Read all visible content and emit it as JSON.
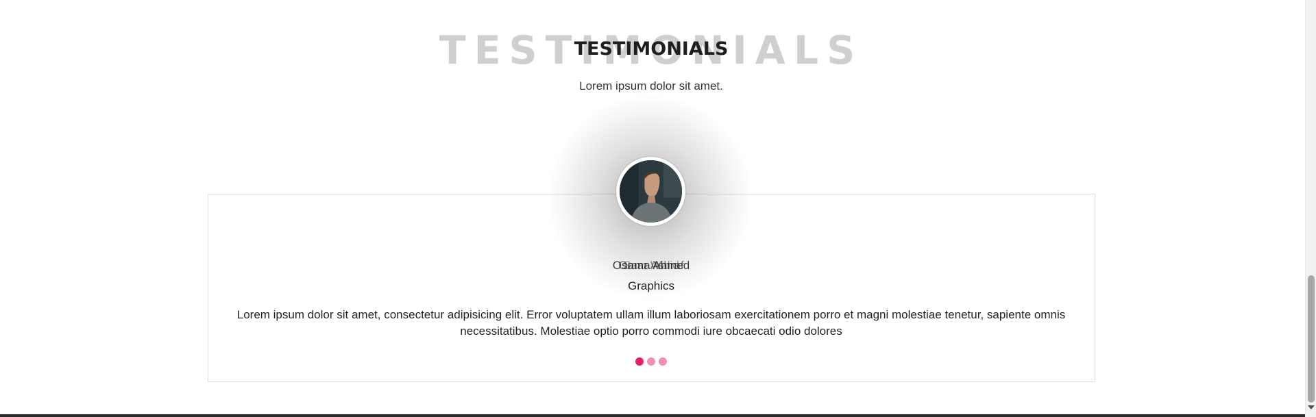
{
  "section": {
    "background_title": "TESTIMONIALS",
    "title": "TESTIMONIALS",
    "subtitle": "Lorem ipsum dolor sit amet."
  },
  "testimonial": {
    "names_overlapping": [
      "Osama Ahmed",
      "Omar Ashraf",
      "Sam Walid"
    ],
    "role": "Graphics",
    "quote": "Lorem ipsum dolor sit amet, consectetur adipisicing elit. Error voluptatem ullam illum laboriosam exercitationem porro et magni molestiae tenetur, sapiente omnis necessitatibus. Molestiae optio porro commodi iure obcaecati odio dolores"
  },
  "carousel": {
    "slides": 3,
    "active_index": 0
  },
  "colors": {
    "accent": "#e91e63",
    "accent_light": "#f48fb1",
    "background_title": "#cfcfcf",
    "title": "#1e1e1e",
    "border": "#e0e0e0"
  },
  "icons": {
    "avatar": "person-photo",
    "scroll_down": "triangle-down"
  }
}
